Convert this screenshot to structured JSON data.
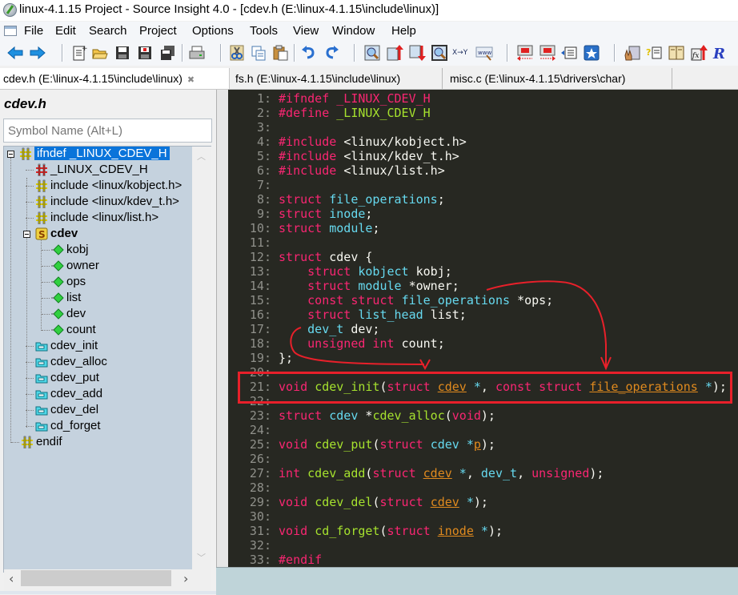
{
  "window": {
    "title": "linux-4.1.15 Project - Source Insight 4.0 - [cdev.h (E:\\linux-4.1.15\\include\\linux)]"
  },
  "menu": [
    "File",
    "Edit",
    "Search",
    "Project",
    "Options",
    "Tools",
    "View",
    "Window",
    "Help"
  ],
  "toolbar": {
    "buttons": [
      {
        "name": "back-icon"
      },
      {
        "name": "forward-icon"
      },
      {
        "name": "new-file-icon"
      },
      {
        "name": "open-file-icon"
      },
      {
        "name": "save-icon"
      },
      {
        "name": "save-as-icon"
      },
      {
        "name": "save-all-icon"
      },
      {
        "name": "print-icon"
      },
      {
        "name": "cut-icon"
      },
      {
        "name": "copy-icon"
      },
      {
        "name": "paste-icon"
      },
      {
        "name": "undo-icon"
      },
      {
        "name": "redo-icon"
      },
      {
        "name": "search-icon"
      },
      {
        "name": "search-backward-icon"
      },
      {
        "name": "search-forward-icon"
      },
      {
        "name": "search-project-icon"
      },
      {
        "name": "replace-icon"
      },
      {
        "name": "browse-web-icon"
      },
      {
        "name": "jump-back-icon"
      },
      {
        "name": "jump-forward-icon"
      },
      {
        "name": "symbol-window-icon"
      },
      {
        "name": "bookmark-icon"
      },
      {
        "name": "context-icon"
      },
      {
        "name": "help-icon"
      },
      {
        "name": "book-icon"
      },
      {
        "name": "function-icon"
      },
      {
        "name": "relation-icon"
      }
    ],
    "replace_label": "X→Y",
    "web_label": "www"
  },
  "tabs": [
    {
      "label": "cdev.h (E:\\linux-4.1.15\\include\\linux)",
      "active": true,
      "close": "✖"
    },
    {
      "label": "fs.h (E:\\linux-4.1.15\\include\\linux)",
      "active": false
    },
    {
      "label": "misc.c (E:\\linux-4.1.15\\drivers\\char)",
      "active": false
    }
  ],
  "symbol_panel": {
    "title": "cdev.h",
    "search_placeholder": "Symbol Name (Alt+L)",
    "tree": [
      {
        "label": "ifndef _LINUX_CDEV_H",
        "icon": "macro-icon",
        "selected": true
      },
      {
        "label": "_LINUX_CDEV_H",
        "icon": "define-icon"
      },
      {
        "label": "include <linux/kobject.h>",
        "icon": "macro-icon"
      },
      {
        "label": "include <linux/kdev_t.h>",
        "icon": "macro-icon"
      },
      {
        "label": "include <linux/list.h>",
        "icon": "macro-icon"
      },
      {
        "label": "cdev",
        "icon": "struct-icon",
        "bold": true
      },
      {
        "label": "kobj",
        "icon": "member-icon"
      },
      {
        "label": "owner",
        "icon": "member-icon"
      },
      {
        "label": "ops",
        "icon": "member-icon"
      },
      {
        "label": "list",
        "icon": "member-icon"
      },
      {
        "label": "dev",
        "icon": "member-icon"
      },
      {
        "label": "count",
        "icon": "member-icon"
      },
      {
        "label": "cdev_init",
        "icon": "function-prototype-icon"
      },
      {
        "label": "cdev_alloc",
        "icon": "function-prototype-icon"
      },
      {
        "label": "cdev_put",
        "icon": "function-prototype-icon"
      },
      {
        "label": "cdev_add",
        "icon": "function-prototype-icon"
      },
      {
        "label": "cdev_del",
        "icon": "function-prototype-icon"
      },
      {
        "label": "cd_forget",
        "icon": "function-prototype-icon"
      },
      {
        "label": "endif",
        "icon": "macro-icon"
      }
    ]
  },
  "editor": {
    "lines": [
      {
        "n": "1:",
        "t": [
          [
            "pp",
            "#ifndef "
          ],
          [
            "kw",
            "_LINUX_CDEV_H"
          ]
        ]
      },
      {
        "n": "2:",
        "t": [
          [
            "pp",
            "#define "
          ],
          [
            "fn",
            "_LINUX_CDEV_H"
          ]
        ]
      },
      {
        "n": "3:",
        "t": []
      },
      {
        "n": "4:",
        "t": [
          [
            "pp",
            "#include "
          ],
          [
            "pl",
            "<linux/kobject.h>"
          ]
        ]
      },
      {
        "n": "5:",
        "t": [
          [
            "pp",
            "#include "
          ],
          [
            "pl",
            "<linux/kdev_t.h>"
          ]
        ]
      },
      {
        "n": "6:",
        "t": [
          [
            "pp",
            "#include "
          ],
          [
            "pl",
            "<linux/list.h>"
          ]
        ]
      },
      {
        "n": "7:",
        "t": []
      },
      {
        "n": "8:",
        "t": [
          [
            "kw",
            "struct "
          ],
          [
            "ty",
            "file_operations"
          ],
          [
            "pl",
            ";"
          ]
        ]
      },
      {
        "n": "9:",
        "t": [
          [
            "kw",
            "struct "
          ],
          [
            "ty",
            "inode"
          ],
          [
            "pl",
            ";"
          ]
        ]
      },
      {
        "n": "10:",
        "t": [
          [
            "kw",
            "struct "
          ],
          [
            "ty",
            "module"
          ],
          [
            "pl",
            ";"
          ]
        ]
      },
      {
        "n": "11:",
        "t": []
      },
      {
        "n": "12:",
        "t": [
          [
            "kw",
            "struct "
          ],
          [
            "pl",
            "cdev {"
          ]
        ]
      },
      {
        "n": "13:",
        "t": [
          [
            "pl",
            "    "
          ],
          [
            "kw",
            "struct "
          ],
          [
            "ty",
            "kobject "
          ],
          [
            "pl",
            "kobj;"
          ]
        ]
      },
      {
        "n": "14:",
        "t": [
          [
            "pl",
            "    "
          ],
          [
            "kw",
            "struct "
          ],
          [
            "ty",
            "module "
          ],
          [
            "pl",
            "*owner;"
          ]
        ]
      },
      {
        "n": "15:",
        "t": [
          [
            "pl",
            "    "
          ],
          [
            "kw",
            "const struct "
          ],
          [
            "ty",
            "file_operations "
          ],
          [
            "pl",
            "*ops;"
          ]
        ]
      },
      {
        "n": "16:",
        "t": [
          [
            "pl",
            "    "
          ],
          [
            "kw",
            "struct "
          ],
          [
            "ty",
            "list_head "
          ],
          [
            "pl",
            "list;"
          ]
        ]
      },
      {
        "n": "17:",
        "t": [
          [
            "pl",
            "    "
          ],
          [
            "ty",
            "dev_t "
          ],
          [
            "pl",
            "dev;"
          ]
        ]
      },
      {
        "n": "18:",
        "t": [
          [
            "pl",
            "    "
          ],
          [
            "kw",
            "unsigned int "
          ],
          [
            "pl",
            "count;"
          ]
        ]
      },
      {
        "n": "19:",
        "t": [
          [
            "pl",
            "};"
          ]
        ]
      },
      {
        "n": "20:",
        "t": []
      },
      {
        "n": "21:",
        "t": [
          [
            "kw",
            "void "
          ],
          [
            "fn",
            "cdev_init"
          ],
          [
            "pl",
            "("
          ],
          [
            "kw",
            "struct "
          ],
          [
            "ref",
            "cdev"
          ],
          [
            "ty",
            " *"
          ],
          [
            "pl",
            ", "
          ],
          [
            "kw",
            "const struct "
          ],
          [
            "ref",
            "file_operations"
          ],
          [
            "ty",
            " *"
          ],
          [
            "pl",
            ");"
          ]
        ]
      },
      {
        "n": "22:",
        "t": []
      },
      {
        "n": "23:",
        "t": [
          [
            "kw",
            "struct "
          ],
          [
            "ty",
            "cdev "
          ],
          [
            "pl",
            "*"
          ],
          [
            "fn",
            "cdev_alloc"
          ],
          [
            "pl",
            "("
          ],
          [
            "kw",
            "void"
          ],
          [
            "pl",
            ");"
          ]
        ]
      },
      {
        "n": "24:",
        "t": []
      },
      {
        "n": "25:",
        "t": [
          [
            "kw",
            "void "
          ],
          [
            "fn",
            "cdev_put"
          ],
          [
            "pl",
            "("
          ],
          [
            "kw",
            "struct "
          ],
          [
            "ty",
            "cdev "
          ],
          [
            "ty",
            "*"
          ],
          [
            "ref",
            "p"
          ],
          [
            "pl",
            ");"
          ]
        ]
      },
      {
        "n": "26:",
        "t": []
      },
      {
        "n": "27:",
        "t": [
          [
            "kw",
            "int "
          ],
          [
            "fn",
            "cdev_add"
          ],
          [
            "pl",
            "("
          ],
          [
            "kw",
            "struct "
          ],
          [
            "ref",
            "cdev"
          ],
          [
            "ty",
            " *"
          ],
          [
            "pl",
            ", "
          ],
          [
            "ty",
            "dev_t"
          ],
          [
            "pl",
            ", "
          ],
          [
            "kw",
            "unsigned"
          ],
          [
            "pl",
            ");"
          ]
        ]
      },
      {
        "n": "28:",
        "t": []
      },
      {
        "n": "29:",
        "t": [
          [
            "kw",
            "void "
          ],
          [
            "fn",
            "cdev_del"
          ],
          [
            "pl",
            "("
          ],
          [
            "kw",
            "struct "
          ],
          [
            "ref",
            "cdev"
          ],
          [
            "ty",
            " *"
          ],
          [
            "pl",
            ");"
          ]
        ]
      },
      {
        "n": "30:",
        "t": []
      },
      {
        "n": "31:",
        "t": [
          [
            "kw",
            "void "
          ],
          [
            "fn",
            "cd_forget"
          ],
          [
            "pl",
            "("
          ],
          [
            "kw",
            "struct "
          ],
          [
            "ref",
            "inode"
          ],
          [
            "ty",
            " *"
          ],
          [
            "pl",
            ");"
          ]
        ]
      },
      {
        "n": "32:",
        "t": []
      },
      {
        "n": "33:",
        "t": [
          [
            "pp",
            "#endif"
          ]
        ]
      }
    ],
    "highlighted_line": "21:"
  },
  "colors": {
    "editor_bg": "#272822",
    "keyword": "#f92672",
    "type": "#66d9ef",
    "function": "#a6e22e",
    "reference": "#e08a1e",
    "annotation": "#e8202a",
    "selection": "#0a74da"
  }
}
